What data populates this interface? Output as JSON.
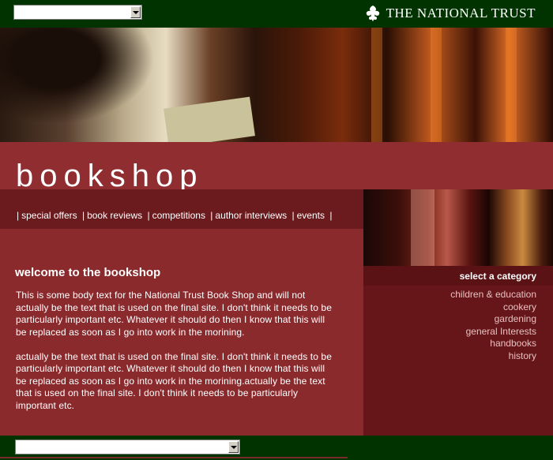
{
  "header": {
    "jump_select_value": "",
    "logo_text": "THE NATIONAL TRUST",
    "logo_icon": "oak-leaf-icon"
  },
  "page": {
    "title": "bookshop"
  },
  "nav": {
    "items": [
      "special offers",
      "book reviews",
      "competitions",
      "author interviews",
      "events"
    ]
  },
  "sidebar": {
    "heading": "select a category",
    "categories": [
      "children & education",
      "cookery",
      "gardening",
      "general Interests",
      "handbooks",
      "history"
    ]
  },
  "main": {
    "heading": "welcome to the bookshop",
    "paragraphs": [
      "This is some body text for the National Trust Book Shop and will not actually be the text that is used on the final site.  I don't think it needs to be particularly important etc.  Whatever it should do then I know that this will be replaced as soon as I go into work in the morining.",
      "actually be the text that is used on the final site.  I don't think it needs to be particularly important etc.  Whatever it should do then I know that this will be replaced as soon as I go into work in the morining.actually be the text that is used on the final site.  I don't think it needs to be particularly important etc."
    ]
  },
  "footer": {
    "jump_select_value": ""
  },
  "colors": {
    "header_green": "#003300",
    "page_red": "#8a2a2d",
    "nav_dark_red": "#6b1a1d",
    "sidebar_red": "#661519"
  }
}
